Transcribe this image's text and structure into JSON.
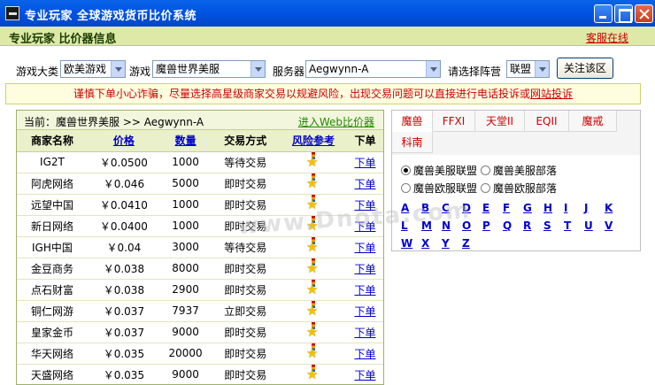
{
  "window": {
    "title": "专业玩家 全球游戏货币比价系统"
  },
  "header": {
    "title": "专业玩家 比价器信息",
    "service_link": "客服在线"
  },
  "filters": {
    "category_label": "游戏大类",
    "category_value": "欧美游戏",
    "game_label": "游戏",
    "game_value": "魔兽世界美服",
    "server_label": "服务器",
    "server_value": "Aegwynn-A",
    "faction_label": "请选择阵营",
    "faction_value": "联盟",
    "close_region_label": "关注该区"
  },
  "notice": {
    "text": "谨慎下单小心诈骗，尽量选择高星级商家交易以规避风险，出现交易问题可以直接进行电话投诉或",
    "link": "网站投诉"
  },
  "breadcrumb": {
    "text": "当前：魔兽世界美服 >> Aegwynn-A",
    "web_link": "进入Web比价器"
  },
  "table": {
    "headers": [
      "商家名称",
      "价格",
      "数量",
      "交易方式",
      "风险参考",
      "下单"
    ],
    "rows": [
      {
        "merchant": "IG2T",
        "price": "￥0.0500",
        "qty": "1000",
        "mode": "等待交易",
        "order": "下单"
      },
      {
        "merchant": "阿虎网络",
        "price": "￥0.046",
        "qty": "5000",
        "mode": "即时交易",
        "order": "下单"
      },
      {
        "merchant": "远望中国",
        "price": "￥0.0410",
        "qty": "1000",
        "mode": "即时交易",
        "order": "下单"
      },
      {
        "merchant": "新日网络",
        "price": "￥0.0400",
        "qty": "1000",
        "mode": "即时交易",
        "order": "下单"
      },
      {
        "merchant": "IGH中国",
        "price": "￥0.04",
        "qty": "3000",
        "mode": "等待交易",
        "order": "下单"
      },
      {
        "merchant": "金豆商务",
        "price": "￥0.038",
        "qty": "8000",
        "mode": "即时交易",
        "order": "下单"
      },
      {
        "merchant": "点石财富",
        "price": "￥0.038",
        "qty": "2900",
        "mode": "即时交易",
        "order": "下单"
      },
      {
        "merchant": "铜仁网游",
        "price": "￥0.037",
        "qty": "7937",
        "mode": "立即交易",
        "order": "下单"
      },
      {
        "merchant": "皇家金币",
        "price": "￥0.037",
        "qty": "9000",
        "mode": "即时交易",
        "order": "下单"
      },
      {
        "merchant": "华天网络",
        "price": "￥0.035",
        "qty": "20000",
        "mode": "即时交易",
        "order": "下单"
      },
      {
        "merchant": "天盛网络",
        "price": "￥0.035",
        "qty": "9000",
        "mode": "即时交易",
        "order": "下单"
      }
    ]
  },
  "right_panel": {
    "tabs": [
      "魔兽",
      "FFXI",
      "天堂II",
      "EQII",
      "魔戒",
      "科南"
    ],
    "radios": [
      "魔兽美服联盟",
      "魔兽美服部落",
      "魔兽欧服联盟",
      "魔兽欧服部落"
    ],
    "letters": [
      "A",
      "B",
      "C",
      "D",
      "E",
      "F",
      "G",
      "H",
      "I",
      "J",
      "K",
      "L",
      "M",
      "N",
      "O",
      "P",
      "Q",
      "R",
      "S",
      "T",
      "U",
      "V",
      "W",
      "X",
      "Y",
      "Z"
    ]
  },
  "watermark": "www.Dnota.com",
  "colors": {
    "titlebar": "#0054e3",
    "header_bg": "#dee9a8",
    "link_red": "#cc0000",
    "link_blue": "#0000cc"
  }
}
